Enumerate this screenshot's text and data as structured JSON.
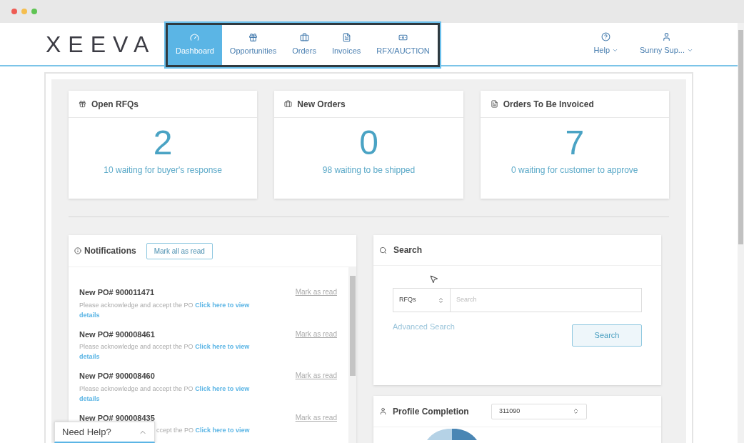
{
  "logo": "XEEVA",
  "nav": [
    {
      "label": "Dashboard",
      "selected": true
    },
    {
      "label": "Opportunities",
      "selected": false
    },
    {
      "label": "Orders",
      "selected": false
    },
    {
      "label": "Invoices",
      "selected": false
    },
    {
      "label": "RFX/AUCTION",
      "selected": false
    }
  ],
  "header_menus": [
    {
      "label": "Help"
    },
    {
      "label": "Sunny Sup..."
    }
  ],
  "stat_cards": [
    {
      "title": "Open RFQs",
      "value": "2",
      "caption": "10 waiting for buyer's response"
    },
    {
      "title": "New Orders",
      "value": "0",
      "caption": "98 waiting to be shipped"
    },
    {
      "title": "Orders To Be Invoiced",
      "value": "7",
      "caption": "0 waiting for customer to approve"
    }
  ],
  "notifications": {
    "title": "Notifications",
    "mark_all": "Mark all as read",
    "items": [
      {
        "kind": "full",
        "title": "New PO# 900011471",
        "text": "Please acknowledge and accept the PO",
        "link": "Click here to view",
        "link_end": "details",
        "action": "Mark as read"
      },
      {
        "kind": "full",
        "title": "New PO# 900008461",
        "text": "Please acknowledge and accept the PO",
        "link": "Click here to view",
        "link_end": "details",
        "action": "Mark as read"
      },
      {
        "kind": "full",
        "title": "New PO# 900008460",
        "text": "Please acknowledge and accept the PO",
        "link": "Click here to view",
        "link_end": "details",
        "action": "Mark as read"
      },
      {
        "kind": "covered",
        "title": "New PO# 900008435",
        "text": "ccept the PO",
        "link": "Click here to view",
        "action": "Mark as read"
      }
    ]
  },
  "search": {
    "title": "Search",
    "type": "RFQs",
    "placeholder": "Search",
    "advanced": "Advanced Search",
    "button": "Search"
  },
  "profile": {
    "title": "Profile Completion",
    "select": "311090"
  },
  "help_widget": {
    "label": "Need Help?"
  }
}
